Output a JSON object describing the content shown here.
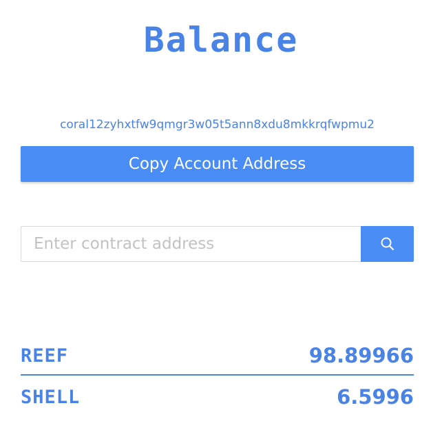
{
  "header": {
    "title": "Balance"
  },
  "account": {
    "address": "coral12zyhxtfw9qmgr3w05t5ann8xdu8mkkrqfwpmu2",
    "copy_label": "Copy Account Address"
  },
  "search": {
    "placeholder": "Enter contract address",
    "value": "",
    "button_icon": "search-icon"
  },
  "balances": [
    {
      "token": "REEF",
      "amount": "98.89966"
    },
    {
      "token": "SHELL",
      "amount": "6.5996"
    }
  ],
  "colors": {
    "accent": "#4a8cf6",
    "text_accent": "#4a83e6",
    "placeholder": "#c2c2c2",
    "input_border": "#d9d9d9"
  }
}
